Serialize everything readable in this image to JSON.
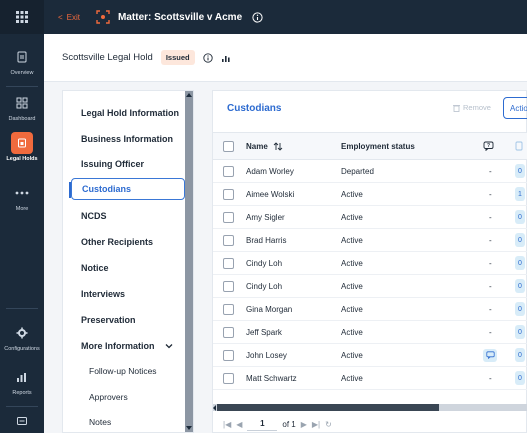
{
  "topbar": {
    "exit_label": "Exit",
    "matter_title": "Matter: Scottsville v Acme"
  },
  "rail": {
    "items": [
      {
        "label": "Overview",
        "icon": "overview-icon"
      },
      {
        "label": "Dashboard",
        "icon": "dashboard-icon"
      },
      {
        "label": "Legal Holds",
        "icon": "legal-holds-icon"
      },
      {
        "label": "More",
        "icon": "more-icon"
      },
      {
        "label": "Configurations",
        "icon": "gear-icon"
      },
      {
        "label": "Reports",
        "icon": "reports-icon"
      },
      {
        "label": "",
        "icon": "tray-icon"
      }
    ],
    "active": "Legal Holds"
  },
  "subheader": {
    "hold_title": "Scottsville Legal Hold",
    "status_badge": "Issued"
  },
  "nav": {
    "items": [
      "Legal Hold Information",
      "Business Information",
      "Issuing Officer",
      "Custodians",
      "NCDS",
      "Other Recipients",
      "Notice",
      "Interviews",
      "Preservation",
      "More Information",
      "Follow-up Notices",
      "Approvers",
      "Notes"
    ],
    "active": "Custodians"
  },
  "main": {
    "title": "Custodians",
    "remove_label": "Remove",
    "actions_label": "Actio",
    "columns": [
      "Name",
      "Employment status"
    ],
    "rows": [
      {
        "name": "Adam Worley",
        "status": "Departed",
        "dash": "-",
        "count": "0"
      },
      {
        "name": "Aimee Wolski",
        "status": "Active",
        "dash": "-",
        "count": "1"
      },
      {
        "name": "Amy Sigler",
        "status": "Active",
        "dash": "-",
        "count": "0"
      },
      {
        "name": "Brad Harris",
        "status": "Active",
        "dash": "-",
        "count": "0"
      },
      {
        "name": "Cindy Loh",
        "status": "Active",
        "dash": "-",
        "count": "0"
      },
      {
        "name": "Cindy Loh",
        "status": "Active",
        "dash": "-",
        "count": "0"
      },
      {
        "name": "Gina Morgan",
        "status": "Active",
        "dash": "-",
        "count": "0"
      },
      {
        "name": "Jeff Spark",
        "status": "Active",
        "dash": "-",
        "count": "0"
      },
      {
        "name": "John Losey",
        "status": "Active",
        "dash": "",
        "count": "0"
      },
      {
        "name": "Matt Schwartz",
        "status": "Active",
        "dash": "-",
        "count": "0"
      }
    ],
    "pager": {
      "page": "1",
      "of_label": "of 1"
    }
  },
  "colors": {
    "rail_bg": "#1b2a3a",
    "accent_orange": "#f06a3d",
    "accent_blue": "#2d6bd0",
    "badge_bg": "#fde7dc"
  }
}
